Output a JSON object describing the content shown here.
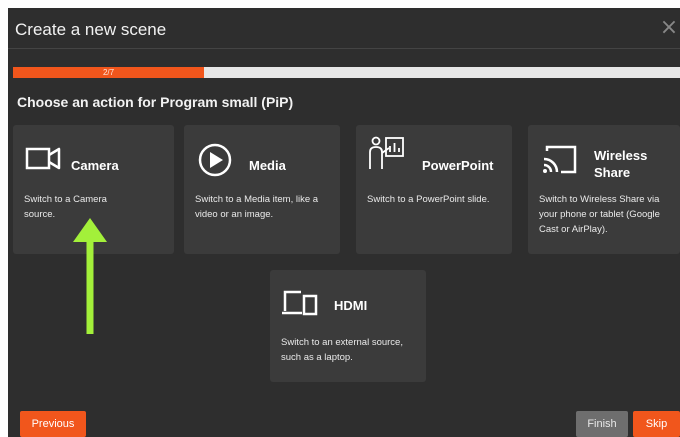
{
  "dialog": {
    "title": "Create a new scene",
    "close_symbol": "×"
  },
  "progress": {
    "label": "2/7",
    "current": 2,
    "total": 7
  },
  "heading": "Choose an action for Program small (PiP)",
  "cards": [
    {
      "label": "Camera",
      "icon": "camera-icon",
      "description": "Switch to a Camera source."
    },
    {
      "label": "Media",
      "icon": "play-icon",
      "description": "Switch to a Media item, like a video or an image."
    },
    {
      "label": "PowerPoint",
      "icon": "presentation-icon",
      "description": "Switch to a PowerPoint slide."
    },
    {
      "label": "Wireless Share",
      "icon": "cast-icon",
      "description": "Switch to Wireless Share via your phone or tablet (Google Cast or AirPlay)."
    },
    {
      "label": "HDMI",
      "icon": "hdmi-display-icon",
      "description": "Switch to an external source, such as a laptop."
    }
  ],
  "annotation": {
    "icon": "arrow-up-icon",
    "color": "#a3f03a"
  },
  "footer": {
    "previous": "Previous",
    "finish": "Finish",
    "skip": "Skip"
  },
  "colors": {
    "accent": "#f1561c",
    "background": "#2e2e2e",
    "card": "#3b3b3b"
  }
}
